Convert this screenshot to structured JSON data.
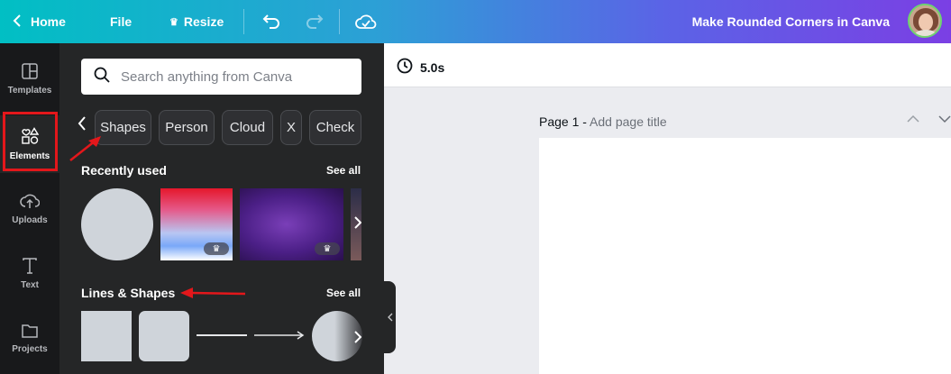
{
  "topbar": {
    "home_label": "Home",
    "file_label": "File",
    "resize_label": "Resize",
    "doc_title": "Make Rounded Corners in Canva",
    "gradient_start": "#01bfc4",
    "gradient_end": "#7b3fe4",
    "icons": [
      "chevron-left-icon",
      "crown-icon",
      "undo-icon",
      "redo-icon",
      "cloud-check-icon"
    ]
  },
  "rail": {
    "items": [
      {
        "label": "Templates",
        "icon": "templates-icon"
      },
      {
        "label": "Elements",
        "icon": "elements-icon",
        "active": true
      },
      {
        "label": "Uploads",
        "icon": "upload-icon"
      },
      {
        "label": "Text",
        "icon": "text-icon"
      },
      {
        "label": "Projects",
        "icon": "folder-icon"
      }
    ],
    "highlight_color": "#e3171b"
  },
  "panel": {
    "search_placeholder": "Search anything from Canva",
    "chips": [
      "Shapes",
      "Person",
      "Cloud",
      "X",
      "Check"
    ],
    "recently_used": {
      "title": "Recently used",
      "see_all": "See all"
    },
    "lines_shapes": {
      "title": "Lines & Shapes",
      "see_all": "See all"
    }
  },
  "editor": {
    "duration": "5.0s",
    "page_label": "Page 1 - ",
    "page_title_placeholder": "Add page title"
  }
}
